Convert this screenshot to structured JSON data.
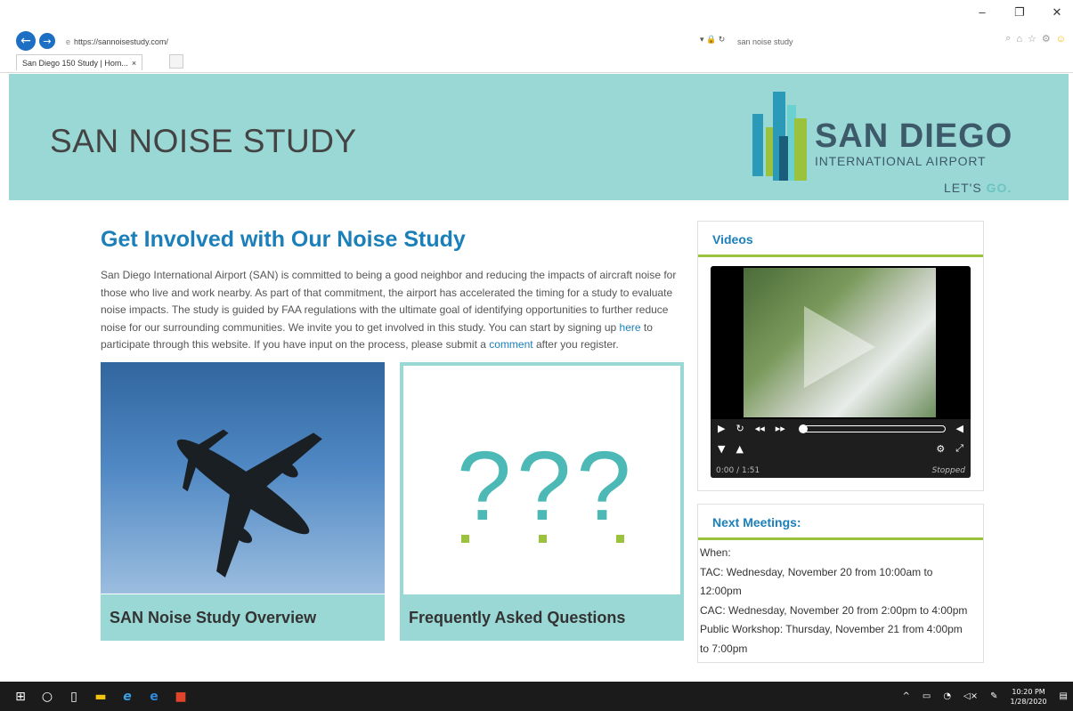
{
  "browser": {
    "url": "https://sannoisestudy.com/",
    "search_text": "san noise study",
    "tab_title": "San Diego 150 Study | Hom...",
    "tab_close": "×",
    "min": "–",
    "max": "❐",
    "close": "✕",
    "back": "←",
    "forward": "→",
    "search_icon": "⌕",
    "addr_tools": "▾ 🔒 ↻",
    "right_icons": [
      "⌂",
      "☆",
      "⚙",
      "☺"
    ]
  },
  "header": {
    "site_title": "SAN NOISE STUDY",
    "logo_line1": "SAN DIEGO",
    "logo_line2": "INTERNATIONAL AIRPORT",
    "logo_tagline_a": "LET'S ",
    "logo_tagline_b": "GO."
  },
  "main": {
    "heading": "Get Involved with Our Noise Study",
    "intro_part1": "San Diego International Airport (SAN) is committed to being a good neighbor and reducing the impacts of aircraft noise for those who live and work nearby. As part of that commitment, the airport has accelerated the timing for a study to evaluate noise impacts. The study is guided by FAA regulations with the ultimate goal of identifying opportunities to further reduce noise for our surrounding communities. We invite you to get involved in this study. You can start by signing up ",
    "intro_link1": "here",
    "intro_part2": " to participate through this website. If you have input on the process, please submit a ",
    "intro_link2": "comment",
    "intro_part3": " after you register.",
    "card1_label": "SAN Noise Study Overview",
    "card2_label": "Frequently Asked Questions",
    "card2_symbol": "???"
  },
  "sidebar": {
    "videos_title": "Videos",
    "video_time": "0:00 / 1:51",
    "video_status": "Stopped",
    "meetings_title": "Next Meetings:",
    "meetings_lines": [
      "When:",
      "TAC: Wednesday, November 20 from 10:00am to 12:00pm",
      "CAC: Wednesday, November 20 from 2:00pm to 4:00pm",
      "Public Workshop: Thursday, November 21 from 4:00pm to 7:00pm"
    ]
  },
  "taskbar": {
    "time": "10:20 PM",
    "date": "1/28/2020"
  },
  "colors": {
    "accent": "#1b7fb9",
    "band": "#9ad8d5",
    "green": "#9ac23c"
  }
}
